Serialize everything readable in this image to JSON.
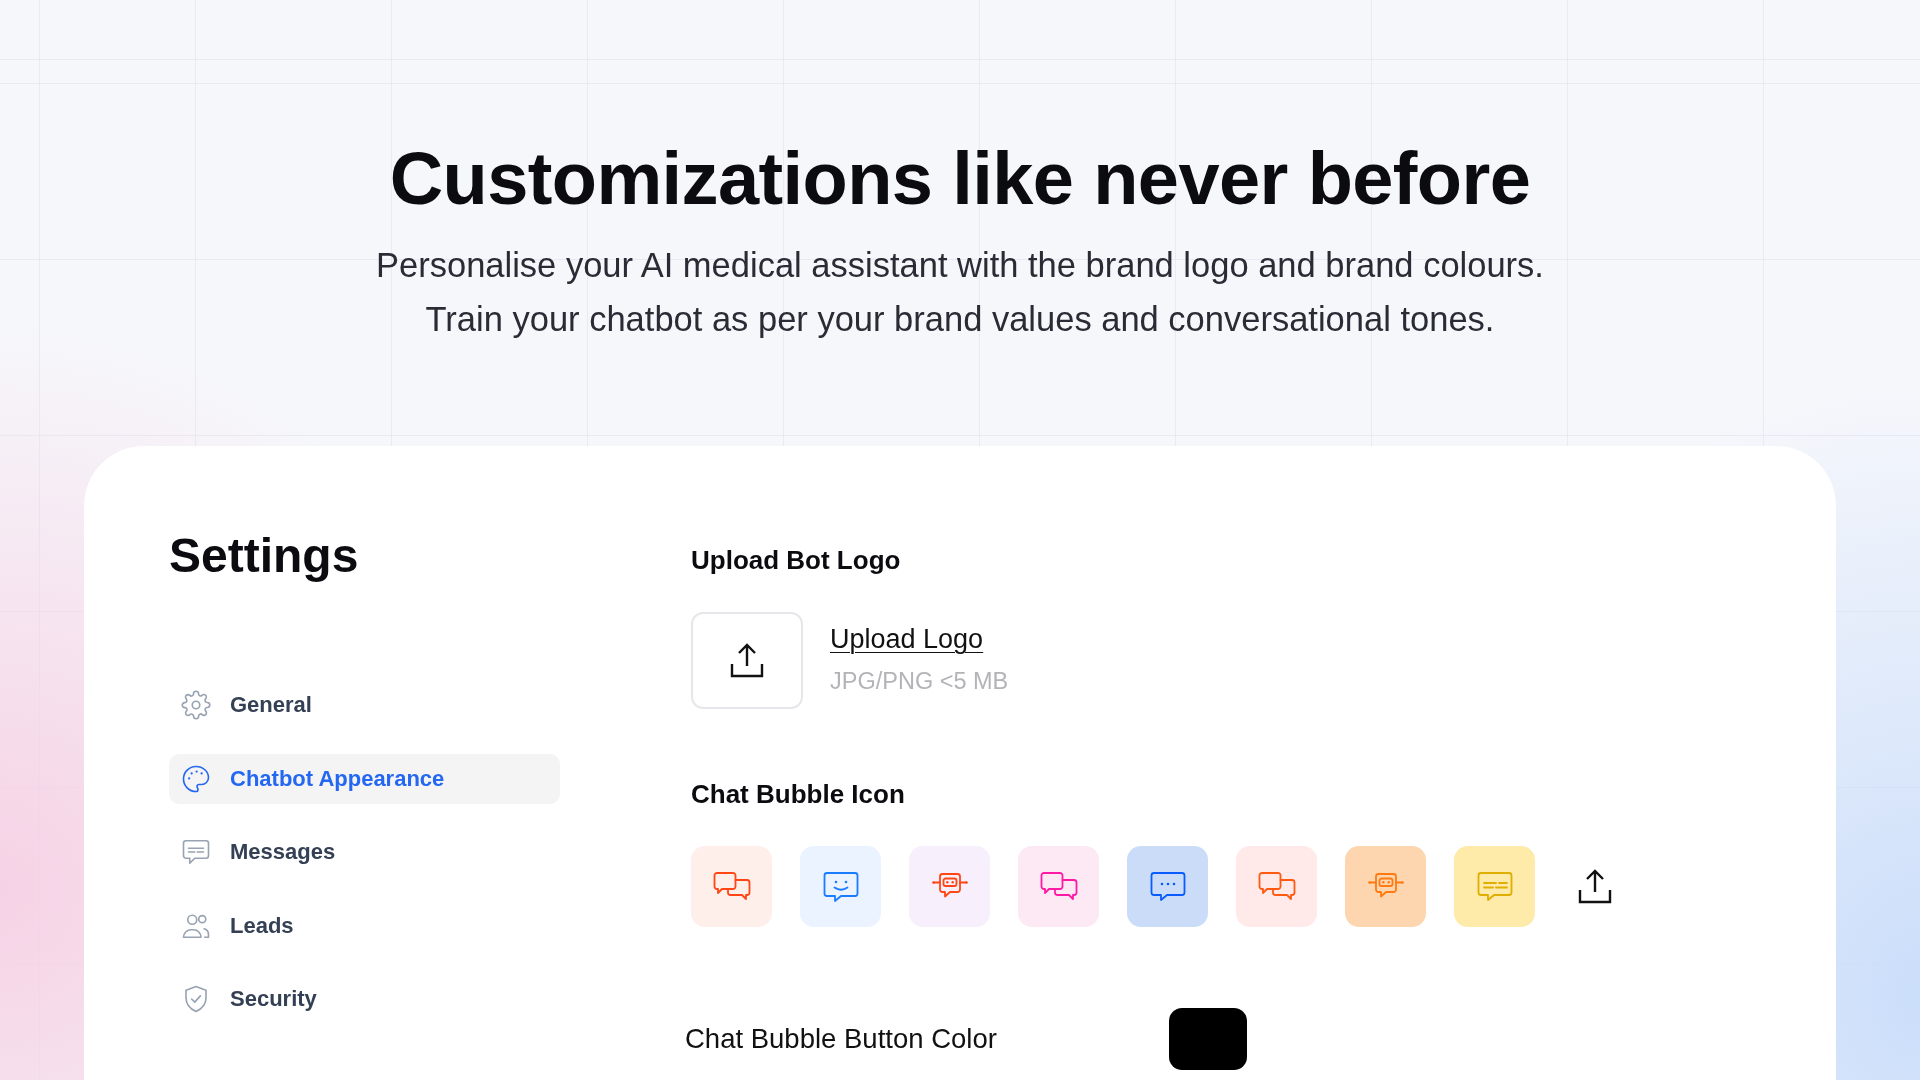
{
  "hero": {
    "title": "Customizations like never before",
    "subtitle_lines": [
      "Personalise your AI medical assistant with the brand logo and brand colours.",
      "Train your chatbot as per your brand values and conversational tones."
    ]
  },
  "settings": {
    "title": "Settings",
    "sidebar": {
      "items": [
        {
          "label": "General",
          "kind": "gear",
          "selected": false
        },
        {
          "label": "Chatbot Appearance",
          "kind": "palette",
          "selected": true
        },
        {
          "label": "Messages",
          "kind": "message",
          "selected": false
        },
        {
          "label": "Leads",
          "kind": "users",
          "selected": false
        },
        {
          "label": "Security",
          "kind": "shield",
          "selected": false
        }
      ]
    },
    "upload_bot_logo": {
      "heading": "Upload Bot Logo",
      "link": "Upload Logo",
      "hint": "JPG/PNG <5 MB"
    },
    "chat_bubble_icon": {
      "heading": "Chat Bubble Icon",
      "options": [
        {
          "kind": "pair",
          "color": "#ff4614",
          "tile": {
            "color": "#ffefea"
          }
        },
        {
          "kind": "smile",
          "color": "#1a7cff",
          "tile": {
            "color": "#eaf3ff"
          }
        },
        {
          "kind": "robot",
          "color": "#ff4614",
          "tile": {
            "color": "#f7effb"
          }
        },
        {
          "kind": "pair",
          "color": "#ff1aa6",
          "tile": {
            "color": "#fde9f4"
          }
        },
        {
          "kind": "dots",
          "color": "#0a5cff",
          "tile": {
            "color": "#cadcf8"
          }
        },
        {
          "kind": "pair",
          "color": "#ff5a10",
          "tile": {
            "color": "#ffe9e9"
          }
        },
        {
          "kind": "robot",
          "color": "#ff7a10",
          "tile": {
            "color": "#fdd6b0"
          }
        },
        {
          "kind": "lines",
          "color": "#dfae00",
          "tile": {
            "color": "#feeaa9"
          }
        }
      ]
    },
    "chat_bubble_button_color": {
      "label": "Chat Bubble Button Color",
      "color": "#000000"
    }
  }
}
